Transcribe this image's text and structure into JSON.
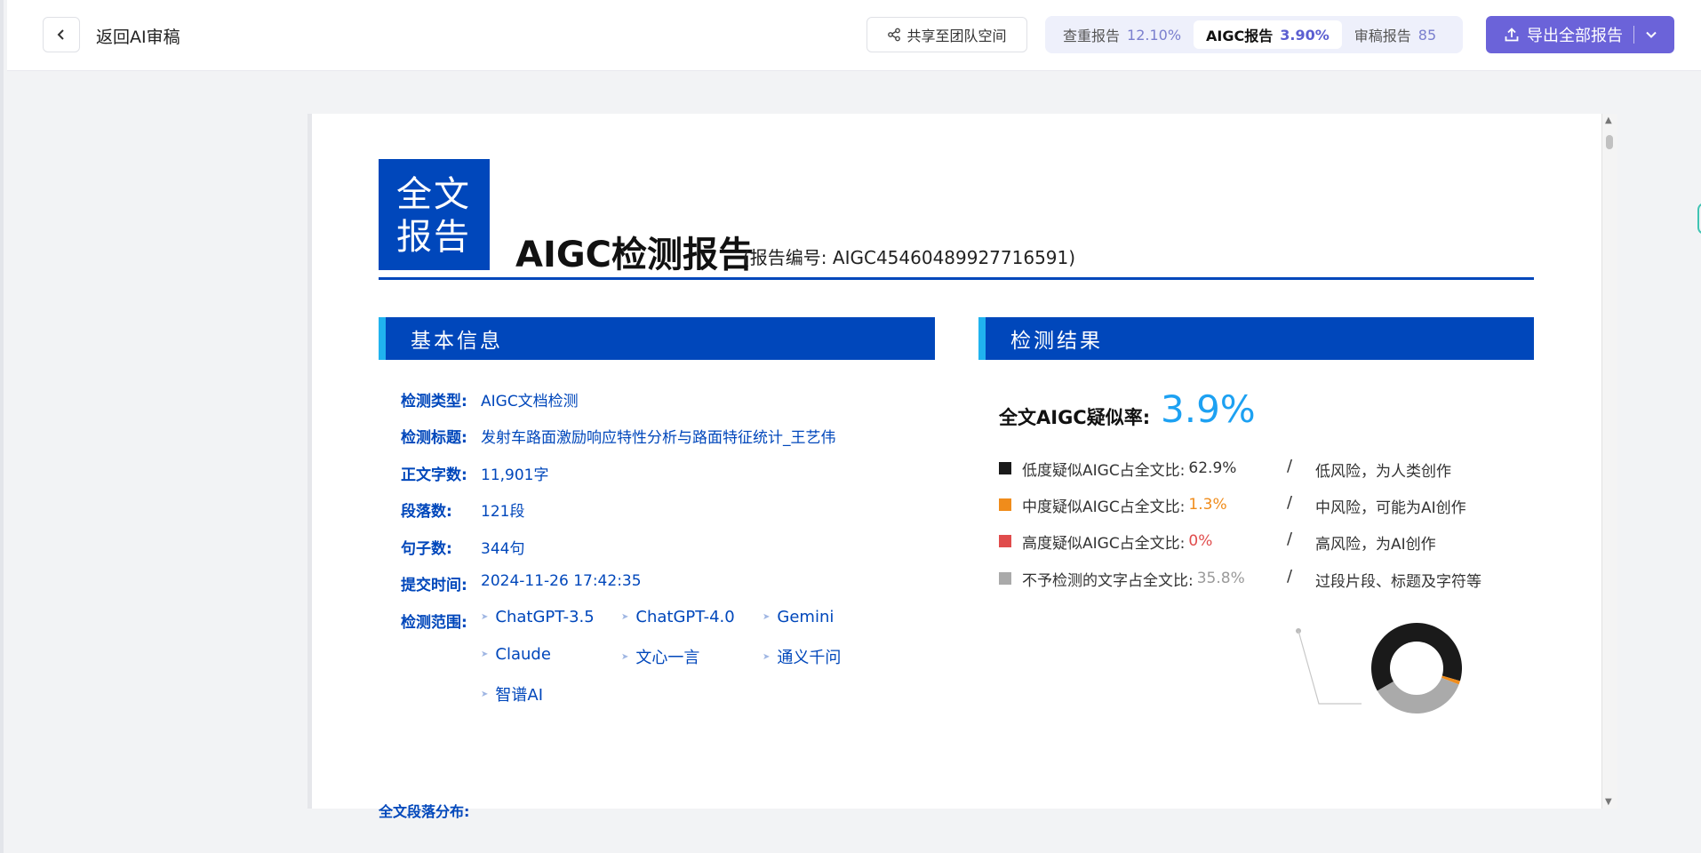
{
  "header": {
    "back_label": "返回AI审稿",
    "share_label": "共享至团队空间",
    "tabs": [
      {
        "label": "查重报告",
        "value": "12.10%"
      },
      {
        "label": "AIGC报告",
        "value": "3.90%"
      },
      {
        "label": "审稿报告",
        "value": "85"
      }
    ],
    "export_label": "导出全部报告"
  },
  "report": {
    "badge_line1": "全文",
    "badge_line2": "报告",
    "title": "AIGC检测报告",
    "number": "(报告编号: AIGC45460489927716591)"
  },
  "basic_info": {
    "heading": "基本信息",
    "rows": [
      {
        "label": "检测类型:",
        "value": "AIGC文档检测"
      },
      {
        "label": "检测标题:",
        "value": "发射车路面激励响应特性分析与路面特征统计_王艺伟"
      },
      {
        "label": "正文字数:",
        "value": "11,901字"
      },
      {
        "label": "段落数:",
        "value": "121段"
      },
      {
        "label": "句子数:",
        "value": "344句"
      },
      {
        "label": "提交时间:",
        "value": "2024-11-26 17:42:35"
      }
    ],
    "scope_label": "检测范围:",
    "scope_items": [
      "ChatGPT-3.5",
      "ChatGPT-4.0",
      "Gemini",
      "Claude",
      "文心一言",
      "通义千问",
      "智谱AI"
    ]
  },
  "result": {
    "heading": "检测结果",
    "rate_label": "全文AIGC疑似率:",
    "rate_value": "3.9%",
    "legend": [
      {
        "label": "低度疑似AIGC占全文比:",
        "value": "62.9%",
        "color": "#1a1a1a",
        "value_color": "#333333",
        "slash": "/",
        "risk": "低风险，为人类创作"
      },
      {
        "label": "中度疑似AIGC占全文比:",
        "value": "1.3%",
        "color": "#f08c1b",
        "value_color": "#f08c1b",
        "slash": "/",
        "risk": "中风险，可能为AI创作"
      },
      {
        "label": "高度疑似AIGC占全文比:",
        "value": "0%",
        "color": "#e04c4c",
        "value_color": "#e04c4c",
        "slash": "/",
        "risk": "高风险，为AI创作"
      },
      {
        "label": "不予检测的文字占全文比:",
        "value": "35.8%",
        "color": "#aaaaaa",
        "value_color": "#9a9a9a",
        "slash": "/",
        "risk": "过段片段、标题及字符等"
      }
    ]
  },
  "footer_partial": "全文段落分布:"
}
